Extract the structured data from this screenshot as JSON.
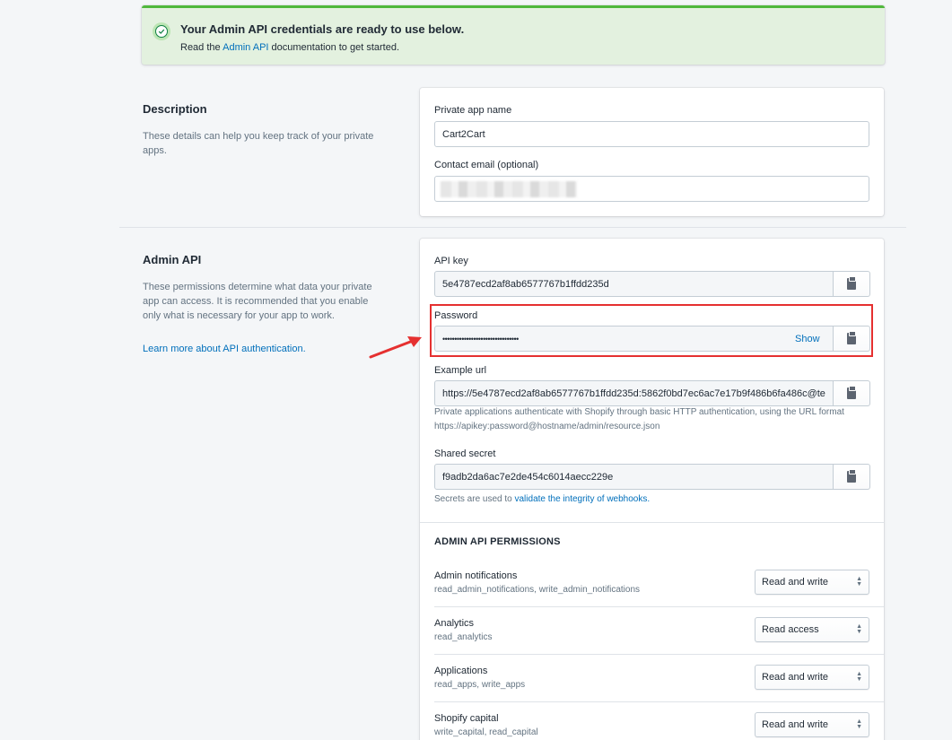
{
  "banner": {
    "title": "Your Admin API credentials are ready to use below.",
    "text_before": "Read the",
    "link": "Admin API",
    "text_after": "documentation to get started."
  },
  "description_section": {
    "title": "Description",
    "desc": "These details can help you keep track of your private apps.",
    "app_name_label": "Private app name",
    "app_name_value": "Cart2Cart",
    "email_label": "Contact email (optional)",
    "email_value": "[redacted]"
  },
  "admin_api_section": {
    "title": "Admin API",
    "desc": "These permissions determine what data your private app can access. It is recommended that you enable only what is necessary for your app to work.",
    "learn_more": "Learn more about API authentication.",
    "api_key_label": "API key",
    "api_key_value": "5e4787ecd2af8ab6577767b1ffdd235d",
    "password_label": "Password",
    "password_value": "••••••••••••••••••••••••••••••••",
    "show_label": "Show",
    "example_url_label": "Example url",
    "example_url_value": "https://5e4787ecd2af8ab6577767b1ffdd235d:5862f0bd7ec6ac7e17b9f486b6fa486c@te",
    "example_url_help_1": "Private applications authenticate with Shopify through basic HTTP authentication, using the URL format",
    "example_url_help_2": "https://apikey:password@hostname/admin/resource.json",
    "shared_secret_label": "Shared secret",
    "shared_secret_value": "f9adb2da6ac7e2de454c6014aecc229e",
    "secret_help_before": "Secrets are used to",
    "secret_help_link": "validate the integrity of webhooks."
  },
  "permissions": {
    "heading": "ADMIN API PERMISSIONS",
    "items": [
      {
        "name": "Admin notifications",
        "scope": "read_admin_notifications, write_admin_notifications",
        "access": "Read and write"
      },
      {
        "name": "Analytics",
        "scope": "read_analytics",
        "access": "Read access"
      },
      {
        "name": "Applications",
        "scope": "read_apps, write_apps",
        "access": "Read and write"
      },
      {
        "name": "Shopify capital",
        "scope": "write_capital, read_capital",
        "access": "Read and write"
      }
    ]
  },
  "colors": {
    "banner_bg": "#e3f1df",
    "banner_border": "#50b83c",
    "link": "#006fbb",
    "annotation": "#e53030"
  }
}
